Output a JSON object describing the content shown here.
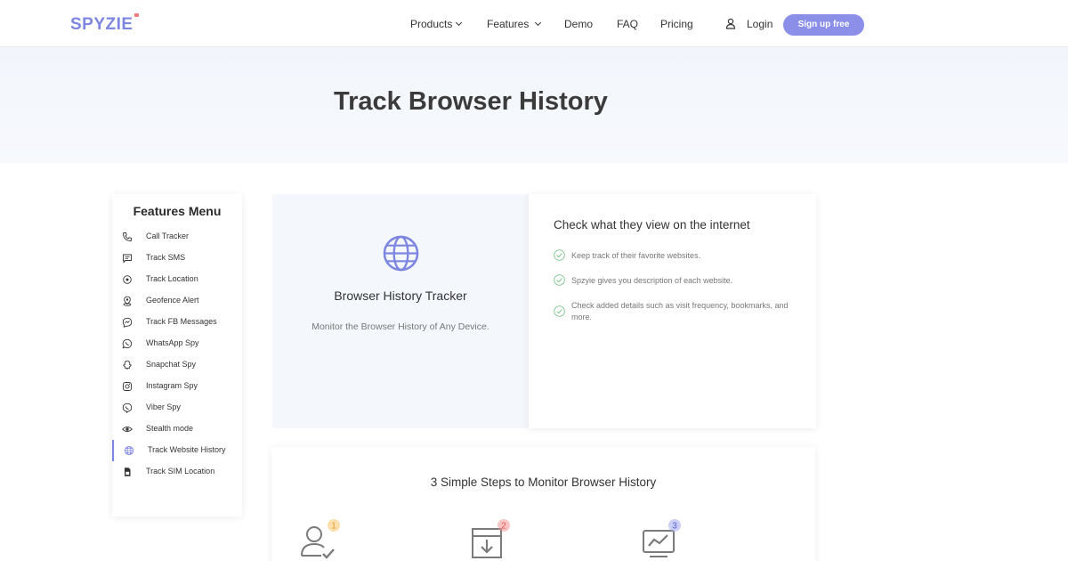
{
  "header": {
    "logo": "SPYZIE",
    "nav": [
      {
        "label": "Products",
        "has_dropdown": true
      },
      {
        "label": "Features",
        "has_dropdown": true
      },
      {
        "label": "Demo",
        "has_dropdown": false
      },
      {
        "label": "FAQ",
        "has_dropdown": false
      },
      {
        "label": "Pricing",
        "has_dropdown": false
      }
    ],
    "login": "Login",
    "login_icon": "user-icon",
    "signup": "Sign up free"
  },
  "hero": {
    "title": "Track Browser History"
  },
  "features_menu": {
    "title": "Features Menu",
    "items": [
      {
        "label": "Call Tracker",
        "icon": "phone-icon"
      },
      {
        "label": "Track SMS",
        "icon": "message-icon"
      },
      {
        "label": "Track Location",
        "icon": "location-icon"
      },
      {
        "label": "Geofence Alert",
        "icon": "geofence-icon"
      },
      {
        "label": "Track FB Messages",
        "icon": "messenger-icon"
      },
      {
        "label": "WhatsApp Spy",
        "icon": "whatsapp-icon"
      },
      {
        "label": "Snapchat Spy",
        "icon": "snapchat-icon"
      },
      {
        "label": "Instagram Spy",
        "icon": "instagram-icon"
      },
      {
        "label": "Viber Spy",
        "icon": "viber-icon"
      },
      {
        "label": "Stealth mode",
        "icon": "eye-icon"
      },
      {
        "label": "Track Website History",
        "icon": "globe-icon",
        "active": true
      },
      {
        "label": "Track SIM Location",
        "icon": "sim-icon"
      }
    ]
  },
  "tracker": {
    "icon": "globe-icon",
    "title": "Browser History Tracker",
    "subtitle": "Monitor the Browser History of Any Device."
  },
  "check": {
    "title": "Check what they view on the internet",
    "items": [
      "Keep track of their favorite websites.",
      "Spzyie gives you description of each website.",
      "Check added details such as visit frequency, bookmarks, and more."
    ]
  },
  "steps": {
    "title": "3 Simple Steps to Monitor Browser History",
    "items": [
      {
        "number": "1",
        "icon": "user-check-icon",
        "badge_color": "#f7c46a"
      },
      {
        "number": "2",
        "icon": "download-box-icon",
        "badge_color": "#f28b8b"
      },
      {
        "number": "3",
        "icon": "monitor-chart-icon",
        "badge_color": "#9aa0ee"
      }
    ]
  },
  "colors": {
    "accent": "#7d86e0",
    "signup_bg": "#8b8fe8",
    "check_green": "#7cc48a",
    "hero_bg": "#f2f6fc"
  }
}
